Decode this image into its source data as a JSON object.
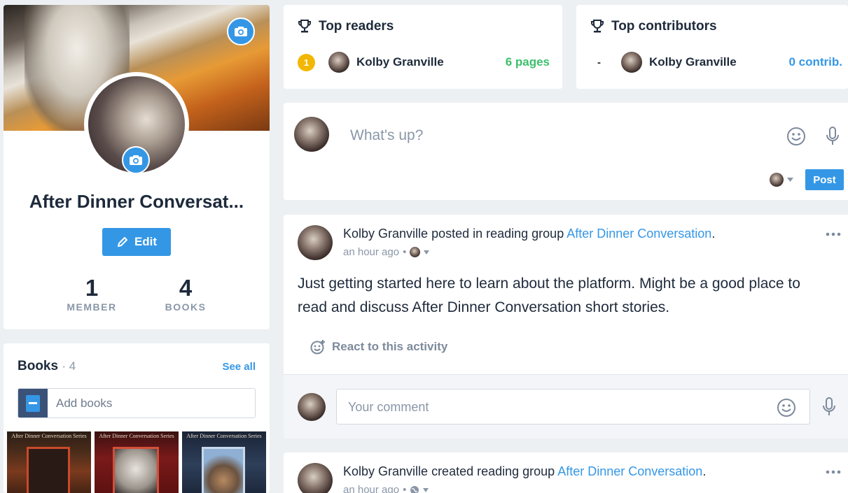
{
  "colors": {
    "accent": "#3497e6",
    "green": "#3cbf6b",
    "gold": "#f2b705",
    "text": "#1e2a3b",
    "muted": "#8a97a8"
  },
  "profile": {
    "name": "After Dinner Conversat...",
    "edit_label": "Edit",
    "stats": [
      {
        "value": "1",
        "label": "MEMBER"
      },
      {
        "value": "4",
        "label": "BOOKS"
      }
    ]
  },
  "books": {
    "title": "Books",
    "count": "· 4",
    "see_all": "See all",
    "add_placeholder": "Add books",
    "covers": [
      {
        "series": "After Dinner Conversation Series"
      },
      {
        "series": "After Dinner Conversation Series"
      },
      {
        "series": "After Dinner Conversation Series"
      }
    ]
  },
  "top_readers": {
    "title": "Top readers",
    "rank": "1",
    "name": "Kolby Granville",
    "value": "6 pages"
  },
  "top_contributors": {
    "title": "Top contributors",
    "rank": "-",
    "name": "Kolby Granville",
    "value": "0 contrib."
  },
  "composer": {
    "placeholder": "What's up?",
    "post_label": "Post"
  },
  "post1": {
    "author": "Kolby Granville",
    "action": " posted in reading group ",
    "group": "After Dinner Conversation",
    "period": ".",
    "time": "an hour ago",
    "body": "Just getting started here to learn about the platform. Might be a good place to read and discuss After Dinner Conversation short stories.",
    "react_label": "React to this activity",
    "comment_placeholder": "Your comment"
  },
  "post2": {
    "author": "Kolby Granville",
    "action": " created reading group ",
    "group": "After Dinner Conversation",
    "period": ".",
    "time": "an hour ago"
  },
  "icons": [
    "camera-icon",
    "pencil-icon",
    "trophy-icon",
    "smiley-icon",
    "mic-icon",
    "more-icon",
    "react-icon",
    "book-icon",
    "globe-icon",
    "chevron-down-icon"
  ]
}
